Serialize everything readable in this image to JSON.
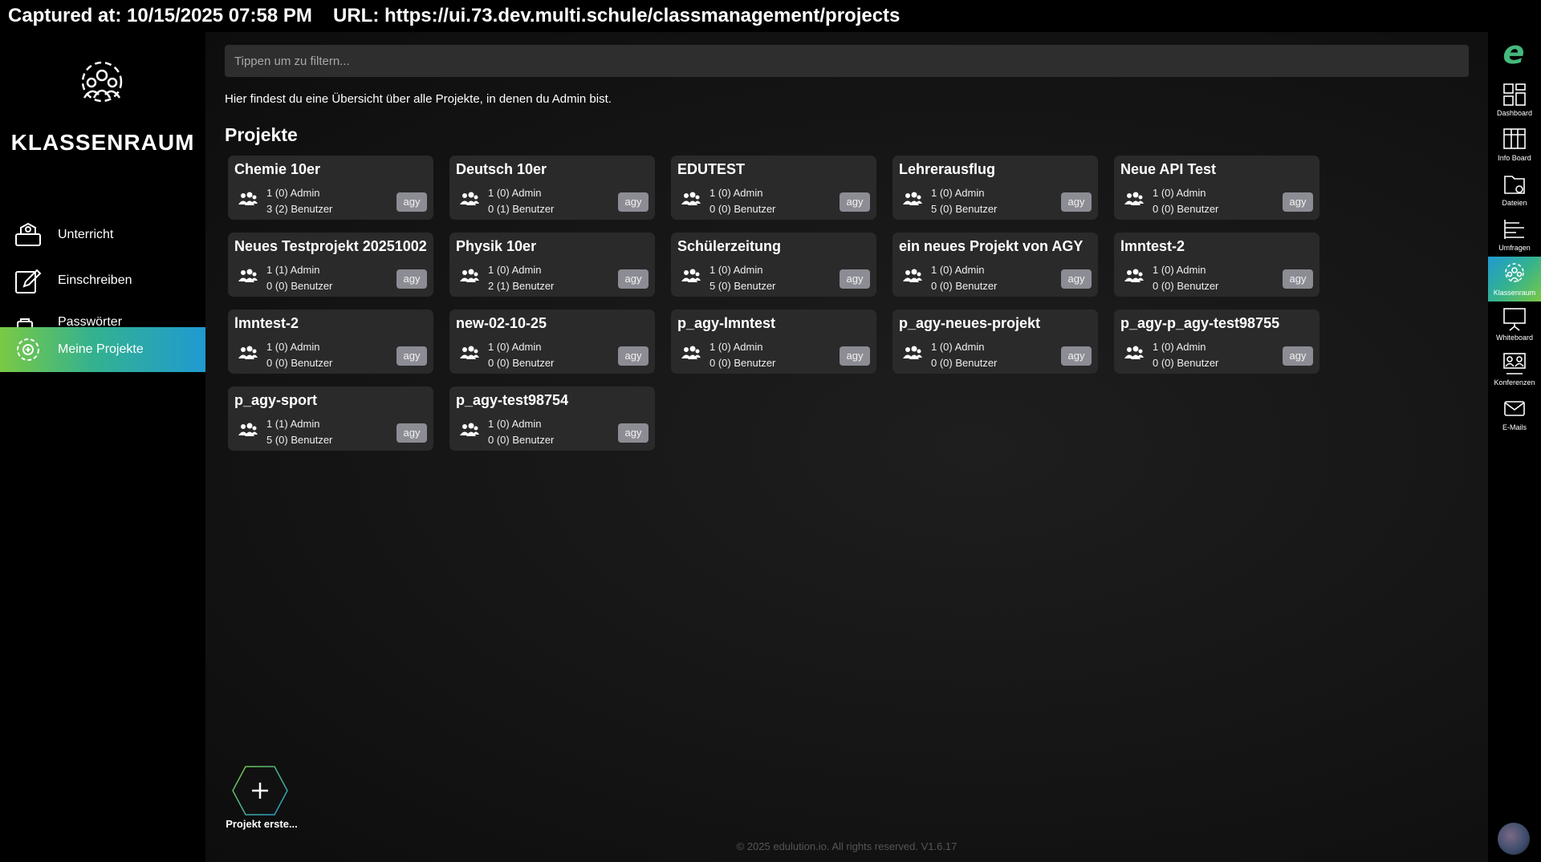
{
  "capture": {
    "time": "Captured at: 10/15/2025 07:58 PM",
    "url": "URL: https://ui.73.dev.multi.schule/classmanagement/projects"
  },
  "sidebar": {
    "title": "KLASSENRAUM",
    "items": [
      {
        "label": "Unterricht",
        "icon": "classroom-icon"
      },
      {
        "label": "Einschreiben",
        "icon": "edit-icon"
      },
      {
        "label": "Passwörter drucken",
        "icon": "printer-password-icon"
      },
      {
        "label": "Meine Projekte",
        "icon": "gear-icon",
        "active": true
      }
    ]
  },
  "filter": {
    "placeholder": "Tippen um zu filtern..."
  },
  "intro": "Hier findest du eine Übersicht über alle Projekte, in denen du Admin bist.",
  "section_title": "Projekte",
  "projects": [
    {
      "name": "Chemie 10er",
      "admin": "1 (0) Admin",
      "users": "3 (2) Benutzer",
      "tag": "agy"
    },
    {
      "name": "Deutsch 10er",
      "admin": "1 (0) Admin",
      "users": "0 (1) Benutzer",
      "tag": "agy"
    },
    {
      "name": "EDUTEST",
      "admin": "1 (0) Admin",
      "users": "0 (0) Benutzer",
      "tag": "agy"
    },
    {
      "name": "Lehrerausflug",
      "admin": "1 (0) Admin",
      "users": "5 (0) Benutzer",
      "tag": "agy"
    },
    {
      "name": "Neue API Test",
      "admin": "1 (0) Admin",
      "users": "0 (0) Benutzer",
      "tag": "agy"
    },
    {
      "name": "Neues Testprojekt 20251002",
      "admin": "1 (1) Admin",
      "users": "0 (0) Benutzer",
      "tag": "agy"
    },
    {
      "name": "Physik 10er",
      "admin": "1 (0) Admin",
      "users": "2 (1) Benutzer",
      "tag": "agy"
    },
    {
      "name": "Schülerzeitung",
      "admin": "1 (0) Admin",
      "users": "5 (0) Benutzer",
      "tag": "agy"
    },
    {
      "name": "ein neues Projekt von AGY",
      "admin": "1 (0) Admin",
      "users": "0 (0) Benutzer",
      "tag": "agy"
    },
    {
      "name": "lmntest-2",
      "admin": "1 (0) Admin",
      "users": "0 (0) Benutzer",
      "tag": "agy"
    },
    {
      "name": "lmntest-2",
      "admin": "1 (0) Admin",
      "users": "0 (0) Benutzer",
      "tag": "agy"
    },
    {
      "name": "new-02-10-25",
      "admin": "1 (0) Admin",
      "users": "0 (0) Benutzer",
      "tag": "agy"
    },
    {
      "name": "p_agy-lmntest",
      "admin": "1 (0) Admin",
      "users": "0 (0) Benutzer",
      "tag": "agy"
    },
    {
      "name": "p_agy-neues-projekt",
      "admin": "1 (0) Admin",
      "users": "0 (0) Benutzer",
      "tag": "agy"
    },
    {
      "name": "p_agy-p_agy-test98755",
      "admin": "1 (0) Admin",
      "users": "0 (0) Benutzer",
      "tag": "agy"
    },
    {
      "name": "p_agy-sport",
      "admin": "1 (1) Admin",
      "users": "5 (0) Benutzer",
      "tag": "agy"
    },
    {
      "name": "p_agy-test98754",
      "admin": "1 (0) Admin",
      "users": "0 (0) Benutzer",
      "tag": "agy"
    }
  ],
  "create_button": {
    "label": "Projekt erste..."
  },
  "footer": "© 2025 edulution.io. All rights reserved. V1.6.17",
  "right_nav": [
    {
      "label": "Dashboard",
      "icon": "dashboard-icon"
    },
    {
      "label": "Info Board",
      "icon": "info-board-icon"
    },
    {
      "label": "Dateien",
      "icon": "files-icon"
    },
    {
      "label": "Umfragen",
      "icon": "surveys-icon"
    },
    {
      "label": "Klassenraum",
      "icon": "classroom-icon",
      "active": true
    },
    {
      "label": "Whiteboard",
      "icon": "whiteboard-icon"
    },
    {
      "label": "Konferenzen",
      "icon": "conferences-icon"
    },
    {
      "label": "E-Mails",
      "icon": "mail-icon"
    }
  ],
  "colors": {
    "accent_green": "#7ac943",
    "accent_blue": "#1f9ad1",
    "card_bg": "#2a2a2b",
    "tag_bg": "#8c8c94"
  }
}
